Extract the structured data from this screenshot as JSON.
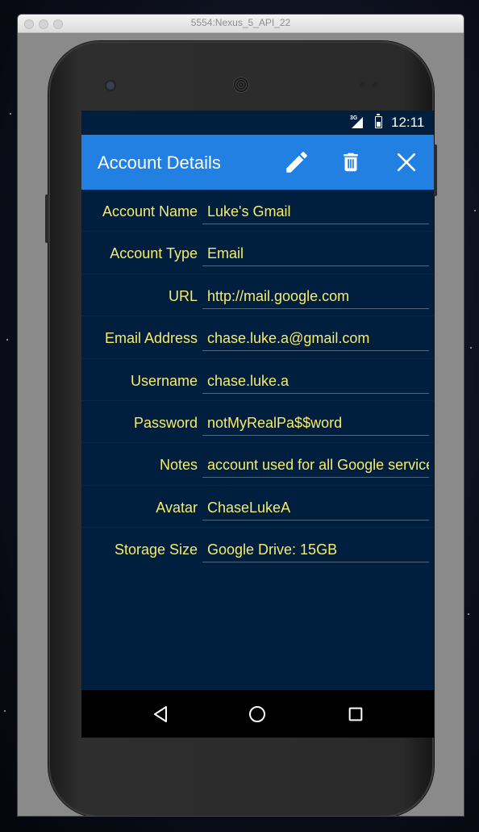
{
  "window": {
    "title": "5554:Nexus_5_API_22"
  },
  "status_bar": {
    "network": "3G",
    "time": "12:11"
  },
  "action_bar": {
    "title": "Account Details",
    "actions": [
      "edit-icon",
      "delete-icon",
      "close-icon"
    ]
  },
  "fields": [
    {
      "label": "Account Name",
      "value": "Luke's Gmail"
    },
    {
      "label": "Account Type",
      "value": "Email"
    },
    {
      "label": "URL",
      "value": "http://mail.google.com"
    },
    {
      "label": "Email Address",
      "value": "chase.luke.a@gmail.com"
    },
    {
      "label": "Username",
      "value": "chase.luke.a"
    },
    {
      "label": "Password",
      "value": "notMyRealPa$$word"
    },
    {
      "label": "Notes",
      "value": "account used for all Google services"
    },
    {
      "label": "Avatar",
      "value": "ChaseLukeA"
    },
    {
      "label": "Storage Size",
      "value": "Google Drive: 15GB"
    }
  ],
  "nav_bar": {
    "buttons": [
      "back-icon",
      "home-icon",
      "recents-icon"
    ]
  },
  "colors": {
    "action_bar": "#2180e1",
    "screen_bg": "#001e3d",
    "text_accent": "#f6eb6e"
  }
}
